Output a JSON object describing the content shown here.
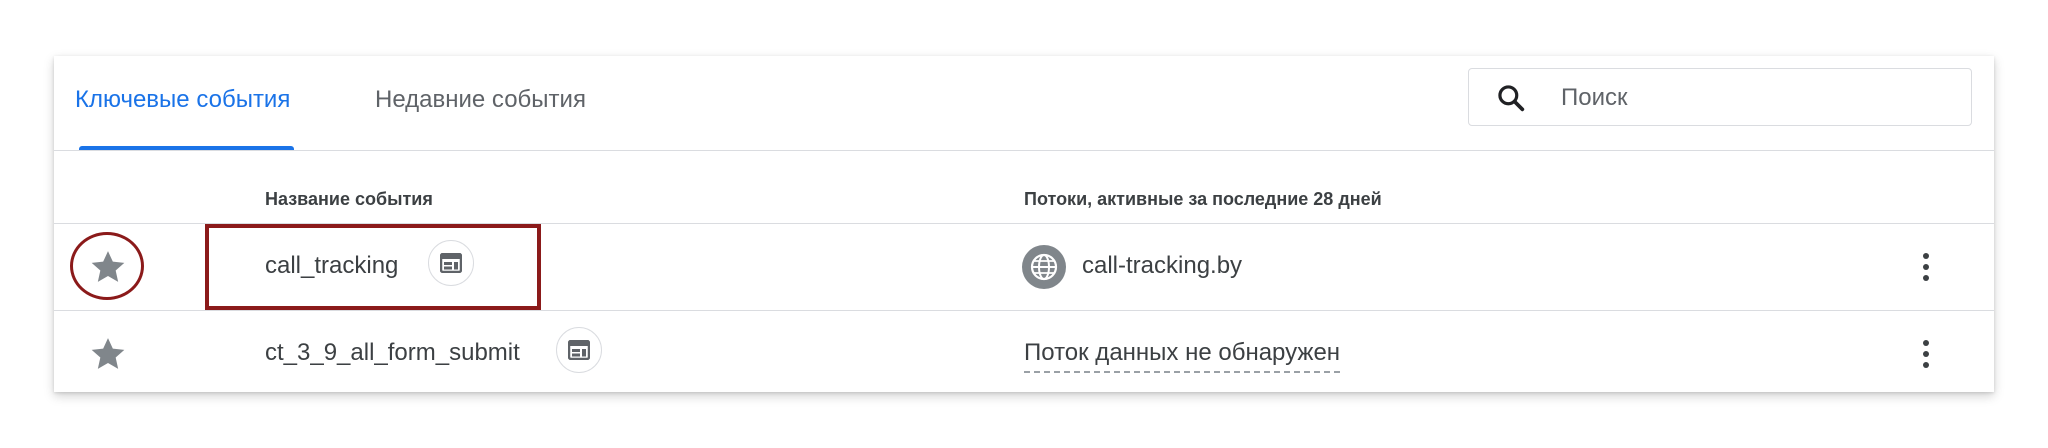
{
  "tabs": [
    {
      "label": "Ключевые события",
      "active": true
    },
    {
      "label": "Недавние события",
      "active": false
    }
  ],
  "search": {
    "placeholder": "Поиск",
    "value": ""
  },
  "table": {
    "columns": {
      "event_name": "Название события",
      "streams": "Потоки, активные за последние 28 дней"
    },
    "rows": [
      {
        "name": "call_tracking",
        "stream": "call-tracking.by",
        "starred": true
      },
      {
        "name": "ct_3_9_all_form_submit",
        "stream": "Поток данных не обнаружен",
        "starred": true
      }
    ]
  },
  "icons": {
    "search": "search-icon",
    "star": "star-icon",
    "badge": "web-event-icon",
    "globe": "globe-icon",
    "menu": "more-vert-icon"
  },
  "colors": {
    "accent": "#1a73e8",
    "highlight": "#8b1a1a",
    "icon_gray": "#80868b",
    "text": "#3c4043"
  }
}
